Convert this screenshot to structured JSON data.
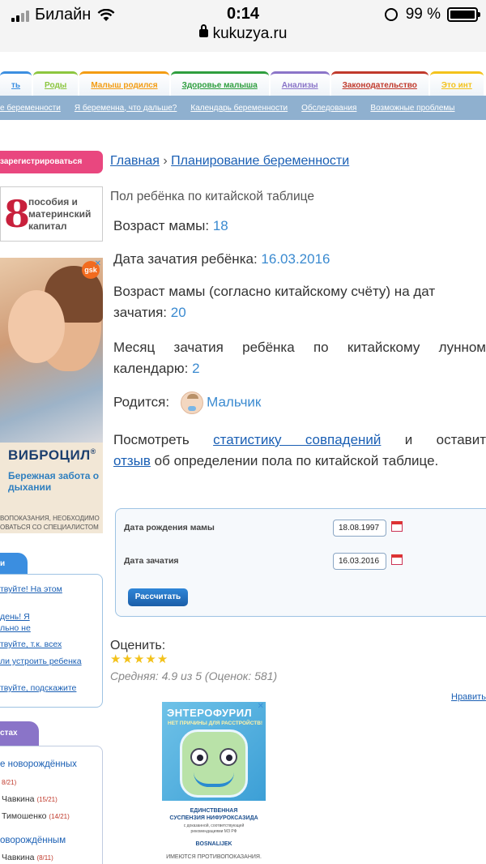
{
  "status_bar": {
    "carrier": "Билайн",
    "time": "0:14",
    "url": "kukuzya.ru",
    "battery": "99 %",
    "battery_level": 0.99
  },
  "tabs": [
    {
      "label": "ть",
      "color": "#3b8ee0"
    },
    {
      "label": "Роды",
      "color": "#8cc63f"
    },
    {
      "label": "Малыш родился",
      "color": "#f39c12"
    },
    {
      "label": "Здоровье малыша",
      "color": "#2e9e3e"
    },
    {
      "label": "Анализы",
      "color": "#8a74c8"
    },
    {
      "label": "Законодательство",
      "color": "#c0392b"
    },
    {
      "label": "Это инт",
      "color": "#f3c21b"
    }
  ],
  "subnav": [
    "е беременности",
    "Я беременна, что дальше?",
    "Календарь беременности",
    "Обследования",
    "Возможные проблемы"
  ],
  "sidebar": {
    "register_label": "зарегистрироваться",
    "promo": {
      "number": "8",
      "text_line1": "пособия и",
      "text_line2": "материнский",
      "text_line3": "капитал"
    },
    "ad": {
      "brand_badge": "gsk",
      "title": "ВИБРОЦИЛ",
      "title_mark": "®",
      "subtitle": "Бережная забота о дыхании",
      "footer_line1": "ВОПОКАЗАНИЯ, НЕОБХОДИМО",
      "footer_line2": "ОВАТЬСЯ СО СПЕЦИАЛИСТОМ"
    },
    "box1_tab": "и",
    "box1_links": [
      "твуйте! На этом",
      "день! Я",
      "льно не",
      "твуйте, т.к. всех",
      "ли устроить ребенка",
      "твуйте, подскажите"
    ],
    "box2_tab": "стах",
    "box2": {
      "link1": "е новорождённых",
      "link1_count": "8/21)",
      "item1_name": "Чавкина",
      "item1_count": "(15/21)",
      "item2_name": "Тимошенко",
      "item2_count": "(14/21)",
      "link2": "оворождённым",
      "item3_name": "Чавкина",
      "item3_count": "(8/11)"
    }
  },
  "breadcrumb": {
    "home": "Главная",
    "sep": "›",
    "section": "Планирование беременности"
  },
  "page_title": "Пол ребёнка по китайской таблице",
  "result": {
    "mother_age_label": "Возраст мамы:",
    "mother_age": "18",
    "conception_date_label": "Дата зачатия ребёнка:",
    "conception_date": "16.03.2016",
    "chinese_age_line1": "Возраст мамы (согласно китайскому счёту) на дат",
    "chinese_age_line2": "зачатия:",
    "chinese_age": "20",
    "lunar_month_line1": "Месяц зачатия ребёнка по китайскому лунном",
    "lunar_month_line2": "календарю:",
    "lunar_month": "2",
    "born_label": "Родится:",
    "born_value": "Мальчик",
    "stats_pre": "Посмотреть",
    "stats_link": "статистику совпадений",
    "stats_post": "и оставит",
    "review_link": "отзыв",
    "review_post": "об определении пола по китайской таблице."
  },
  "form": {
    "mother_birth_label": "Дата рождения мамы",
    "mother_birth_value": "18.08.1997",
    "conception_label": "Дата зачатия",
    "conception_value": "16.03.2016",
    "submit_label": "Рассчитать"
  },
  "rating": {
    "label": "Оценить:",
    "stars": 5,
    "avg_text": "Средняя: 4.9 из 5 (Оценок: 581)",
    "like_label": "Нравить"
  },
  "ad2": {
    "brand": "ЭНТЕРОФУРИЛ",
    "slogan": "НЕТ ПРИЧИНЫ ДЛЯ РАССТРОЙСТВ!",
    "line1": "ЕДИНСТВЕННАЯ",
    "line2": "СУСПЕНЗИЯ НИФУРОКСАЗИДА",
    "line3": "с доказанной, соответствующей",
    "line4": "рекомендациями МЗ РФ",
    "logo": "BOSNALIJEK",
    "warning": "ИМЕЮТСЯ ПРОТИВОПОКАЗАНИЯ."
  }
}
